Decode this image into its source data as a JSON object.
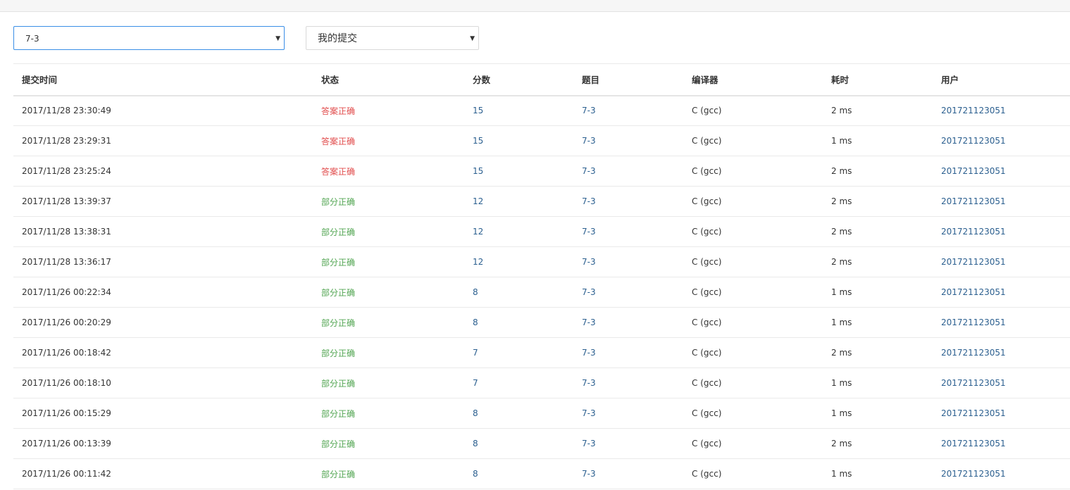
{
  "filters": {
    "problem": "7-3",
    "scope": "我的提交"
  },
  "colors": {
    "accepted": "#e14c4c",
    "partial": "#52a552",
    "link": "#2b5f8f"
  },
  "table": {
    "headers": [
      "提交时间",
      "状态",
      "分数",
      "题目",
      "编译器",
      "耗时",
      "用户"
    ],
    "rows": [
      {
        "time": "2017/11/28 23:30:49",
        "status": "答案正确",
        "status_type": "accepted",
        "score": "15",
        "problem": "7-3",
        "compiler": "C (gcc)",
        "runtime": "2 ms",
        "user": "201721123051"
      },
      {
        "time": "2017/11/28 23:29:31",
        "status": "答案正确",
        "status_type": "accepted",
        "score": "15",
        "problem": "7-3",
        "compiler": "C (gcc)",
        "runtime": "1 ms",
        "user": "201721123051"
      },
      {
        "time": "2017/11/28 23:25:24",
        "status": "答案正确",
        "status_type": "accepted",
        "score": "15",
        "problem": "7-3",
        "compiler": "C (gcc)",
        "runtime": "2 ms",
        "user": "201721123051"
      },
      {
        "time": "2017/11/28 13:39:37",
        "status": "部分正确",
        "status_type": "partial",
        "score": "12",
        "problem": "7-3",
        "compiler": "C (gcc)",
        "runtime": "2 ms",
        "user": "201721123051"
      },
      {
        "time": "2017/11/28 13:38:31",
        "status": "部分正确",
        "status_type": "partial",
        "score": "12",
        "problem": "7-3",
        "compiler": "C (gcc)",
        "runtime": "2 ms",
        "user": "201721123051"
      },
      {
        "time": "2017/11/28 13:36:17",
        "status": "部分正确",
        "status_type": "partial",
        "score": "12",
        "problem": "7-3",
        "compiler": "C (gcc)",
        "runtime": "2 ms",
        "user": "201721123051"
      },
      {
        "time": "2017/11/26 00:22:34",
        "status": "部分正确",
        "status_type": "partial",
        "score": "8",
        "problem": "7-3",
        "compiler": "C (gcc)",
        "runtime": "1 ms",
        "user": "201721123051"
      },
      {
        "time": "2017/11/26 00:20:29",
        "status": "部分正确",
        "status_type": "partial",
        "score": "8",
        "problem": "7-3",
        "compiler": "C (gcc)",
        "runtime": "1 ms",
        "user": "201721123051"
      },
      {
        "time": "2017/11/26 00:18:42",
        "status": "部分正确",
        "status_type": "partial",
        "score": "7",
        "problem": "7-3",
        "compiler": "C (gcc)",
        "runtime": "2 ms",
        "user": "201721123051"
      },
      {
        "time": "2017/11/26 00:18:10",
        "status": "部分正确",
        "status_type": "partial",
        "score": "7",
        "problem": "7-3",
        "compiler": "C (gcc)",
        "runtime": "1 ms",
        "user": "201721123051"
      },
      {
        "time": "2017/11/26 00:15:29",
        "status": "部分正确",
        "status_type": "partial",
        "score": "8",
        "problem": "7-3",
        "compiler": "C (gcc)",
        "runtime": "1 ms",
        "user": "201721123051"
      },
      {
        "time": "2017/11/26 00:13:39",
        "status": "部分正确",
        "status_type": "partial",
        "score": "8",
        "problem": "7-3",
        "compiler": "C (gcc)",
        "runtime": "2 ms",
        "user": "201721123051"
      },
      {
        "time": "2017/11/26 00:11:42",
        "status": "部分正确",
        "status_type": "partial",
        "score": "8",
        "problem": "7-3",
        "compiler": "C (gcc)",
        "runtime": "1 ms",
        "user": "201721123051"
      }
    ]
  }
}
